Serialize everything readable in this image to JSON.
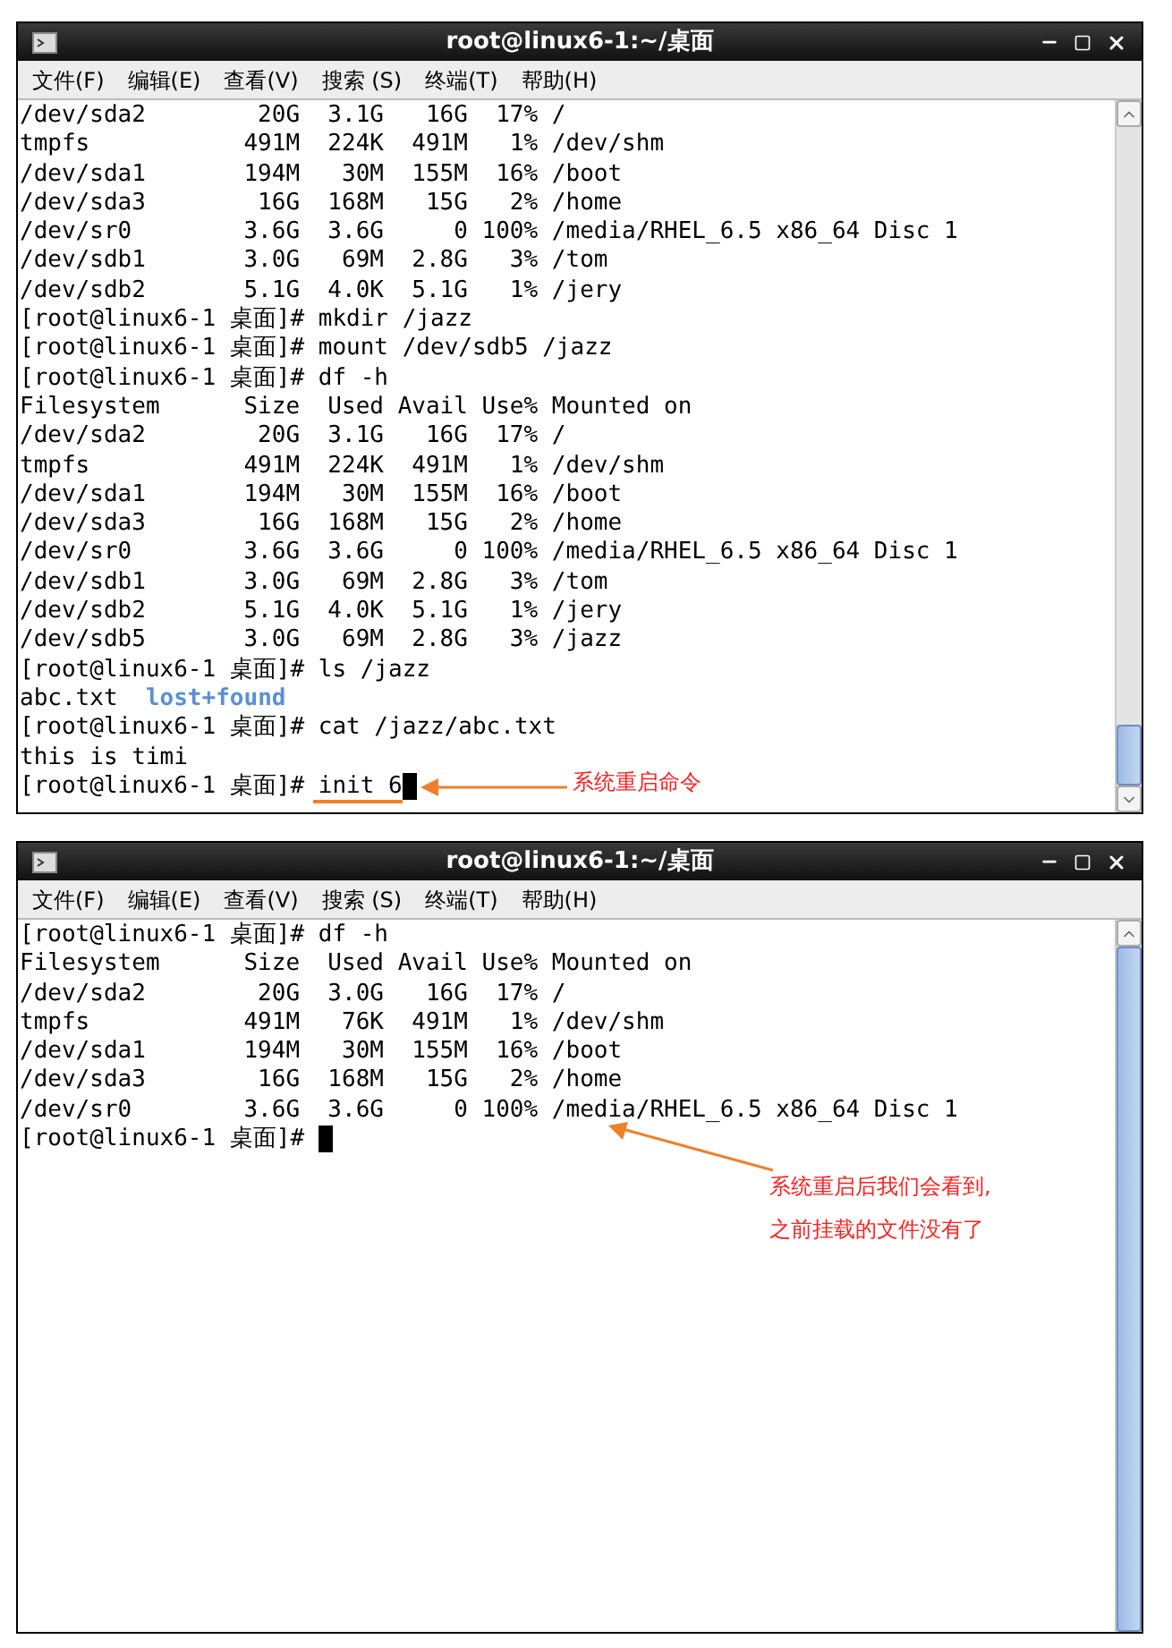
{
  "windows": [
    {
      "title": "root@linux6-1:~/桌面",
      "menu": [
        "文件(F)",
        "编辑(E)",
        "查看(V)",
        "搜索 (S)",
        "终端(T)",
        "帮助(H)"
      ],
      "lines": [
        {
          "text": "/dev/sda2        20G  3.1G   16G  17% /"
        },
        {
          "text": "tmpfs           491M  224K  491M   1% /dev/shm"
        },
        {
          "text": "/dev/sda1       194M   30M  155M  16% /boot"
        },
        {
          "text": "/dev/sda3        16G  168M   15G   2% /home"
        },
        {
          "text": "/dev/sr0        3.6G  3.6G     0 100% /media/RHEL_6.5 x86_64 Disc 1"
        },
        {
          "text": "/dev/sdb1       3.0G   69M  2.8G   3% /tom"
        },
        {
          "text": "/dev/sdb2       5.1G  4.0K  5.1G   1% /jery"
        },
        {
          "text": "[root@linux6-1 桌面]# mkdir /jazz"
        },
        {
          "text": "[root@linux6-1 桌面]# mount /dev/sdb5 /jazz"
        },
        {
          "text": "[root@linux6-1 桌面]# df -h"
        },
        {
          "text": "Filesystem      Size  Used Avail Use% Mounted on"
        },
        {
          "text": "/dev/sda2        20G  3.1G   16G  17% /"
        },
        {
          "text": "tmpfs           491M  224K  491M   1% /dev/shm"
        },
        {
          "text": "/dev/sda1       194M   30M  155M  16% /boot"
        },
        {
          "text": "/dev/sda3        16G  168M   15G   2% /home"
        },
        {
          "text": "/dev/sr0        3.6G  3.6G     0 100% /media/RHEL_6.5 x86_64 Disc 1"
        },
        {
          "text": "/dev/sdb1       3.0G   69M  2.8G   3% /tom"
        },
        {
          "text": "/dev/sdb2       5.1G  4.0K  5.1G   1% /jery"
        },
        {
          "text": "/dev/sdb5       3.0G   69M  2.8G   3% /jazz"
        },
        {
          "text": "[root@linux6-1 桌面]# ls /jazz"
        },
        {
          "text": "abc.txt  ",
          "dir": "lost+found"
        },
        {
          "text": "[root@linux6-1 桌面]# cat /jazz/abc.txt"
        },
        {
          "text": "this is timi"
        },
        {
          "text": "[root@linux6-1 桌面]# init 6",
          "cursor": true
        }
      ],
      "annotation": {
        "underline": true,
        "lines": [
          "系统重启命令"
        ]
      }
    },
    {
      "title": "root@linux6-1:~/桌面",
      "menu": [
        "文件(F)",
        "编辑(E)",
        "查看(V)",
        "搜索 (S)",
        "终端(T)",
        "帮助(H)"
      ],
      "lines": [
        {
          "text": "[root@linux6-1 桌面]# df -h"
        },
        {
          "text": "Filesystem      Size  Used Avail Use% Mounted on"
        },
        {
          "text": "/dev/sda2        20G  3.0G   16G  17% /"
        },
        {
          "text": "tmpfs           491M   76K  491M   1% /dev/shm"
        },
        {
          "text": "/dev/sda1       194M   30M  155M  16% /boot"
        },
        {
          "text": "/dev/sda3        16G  168M   15G   2% /home"
        },
        {
          "text": "/dev/sr0        3.6G  3.6G     0 100% /media/RHEL_6.5 x86_64 Disc 1"
        },
        {
          "text": "[root@linux6-1 桌面]# ",
          "cursor": true
        }
      ],
      "annotation": {
        "underline": false,
        "lines": [
          "系统重启后我们会看到,",
          "之前挂载的文件没有了"
        ]
      }
    }
  ]
}
